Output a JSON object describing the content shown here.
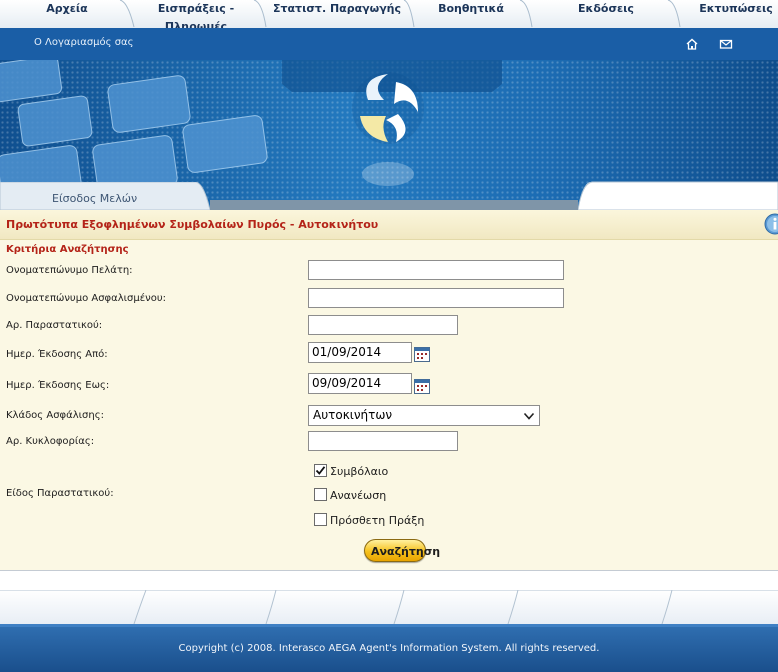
{
  "top_menu": [
    {
      "label": "Αρχεία"
    },
    {
      "label": "Εισπράξεις - Πληρωμές"
    },
    {
      "label": "Στατιστ. Παραγωγής"
    },
    {
      "label": "Βοηθητικά"
    },
    {
      "label": "Εκδόσεις"
    },
    {
      "label": "Εκτυπώσεις"
    }
  ],
  "header": {
    "account_link": "Ο Λογαριασμός σας",
    "members_tab": "Είσοδος Μελών"
  },
  "page": {
    "title": "Πρωτότυπα Εξοφλημένων Συμβολαίων Πυρός - Αυτοκινήτου",
    "section": "Κριτήρια Αναζήτησης"
  },
  "form": {
    "customer_name_label": "Ονοματεπώνυμο Πελάτη:",
    "customer_name_value": "",
    "insured_name_label": "Ονοματεπώνυμο Ασφαλισμένου:",
    "insured_name_value": "",
    "document_no_label": "Αρ. Παραστατικού:",
    "document_no_value": "",
    "date_from_label": "Ημερ. Έκδοσης Από:",
    "date_from_value": "01/09/2014",
    "date_to_label": "Ημερ. Έκδοσης Εως:",
    "date_to_value": "09/09/2014",
    "branch_label": "Κλάδος Ασφάλισης:",
    "branch_value": "Αυτοκινήτων",
    "plate_label": "Αρ. Κυκλοφορίας:",
    "plate_value": "",
    "doc_type_label": "Είδος Παραστατικού:",
    "doc_types": [
      {
        "label": "Συμβόλαιο",
        "checked": true
      },
      {
        "label": "Ανανέωση",
        "checked": false
      },
      {
        "label": "Πρόσθετη Πράξη",
        "checked": false
      }
    ],
    "search_button": "Αναζήτηση"
  },
  "footer": {
    "copyright": "Copyright (c) 2008. Interasco AEGA Agent's Information System. All rights reserved."
  },
  "icons": {
    "home": "home-icon",
    "mail": "mail-icon",
    "calendar": "calendar-icon",
    "info": "info-icon",
    "logo": "company-logo"
  },
  "colors": {
    "header_blue": "#1a5ea6",
    "title_red": "#b42318",
    "content_bg": "#fbf8e4",
    "button_gold": "#f6c11c"
  }
}
